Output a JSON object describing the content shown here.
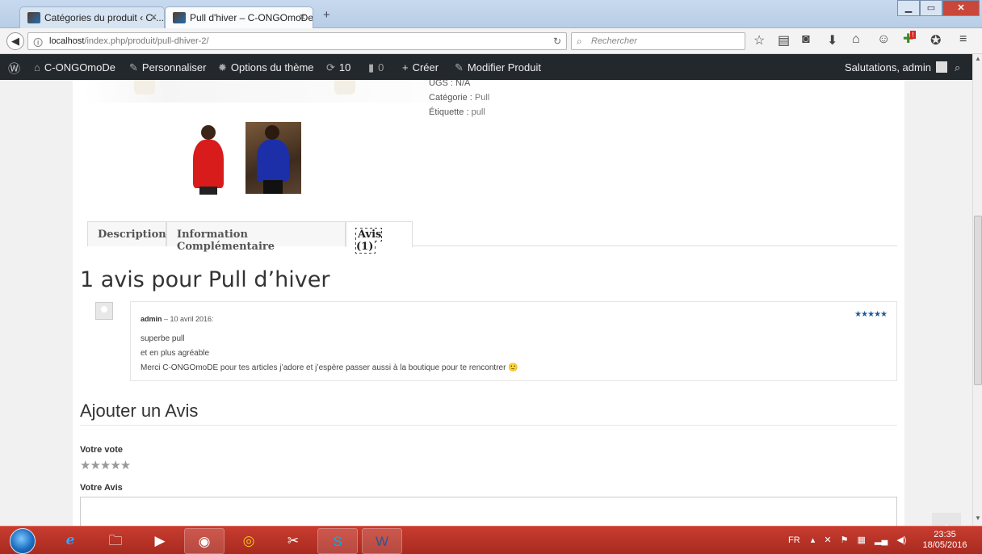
{
  "browser": {
    "tabs": [
      {
        "title": "Catégories du produit ‹ C-..."
      },
      {
        "title": "Pull d'hiver – C-ONGOmoDe"
      }
    ],
    "url_host": "localhost",
    "url_path": "/index.php/produit/pull-dhiver-2/",
    "search_placeholder": "Rechercher",
    "notification_badge": "!"
  },
  "adminbar": {
    "site_name": "C-ONGOmoDe",
    "customize": "Personnaliser",
    "theme_options": "Options du thème",
    "updates": "10",
    "comments": "0",
    "new": "Créer",
    "edit": "Modifier Produit",
    "greeting": "Salutations, admin"
  },
  "product_meta": {
    "sku": "UGS : N/A",
    "category_label": "Catégorie :",
    "category": "Pull",
    "tag_label": "Étiquette :",
    "tag": "pull"
  },
  "product_tabs": [
    {
      "label": "Description"
    },
    {
      "label": "Information Complémentaire"
    },
    {
      "label": "Avis (1)"
    }
  ],
  "reviews": {
    "title": "1 avis pour Pull d’hiver",
    "author": "admin",
    "date": " – 10 avril 2016:",
    "stars": "★★★★★",
    "lines": [
      "superbe pull",
      "et en plus agréable",
      "Merci C-ONGOmoDE pour tes articles j’adore et j’espère passer aussi à la boutique pour te rencontrer 🙂"
    ]
  },
  "add_review": {
    "title": "Ajouter un Avis",
    "vote_label": "Votre vote",
    "vote_stars": "★★★★★",
    "review_label": "Votre Avis"
  },
  "taskbar": {
    "lang": "FR",
    "time": "23:35",
    "date": "18/05/2016"
  }
}
